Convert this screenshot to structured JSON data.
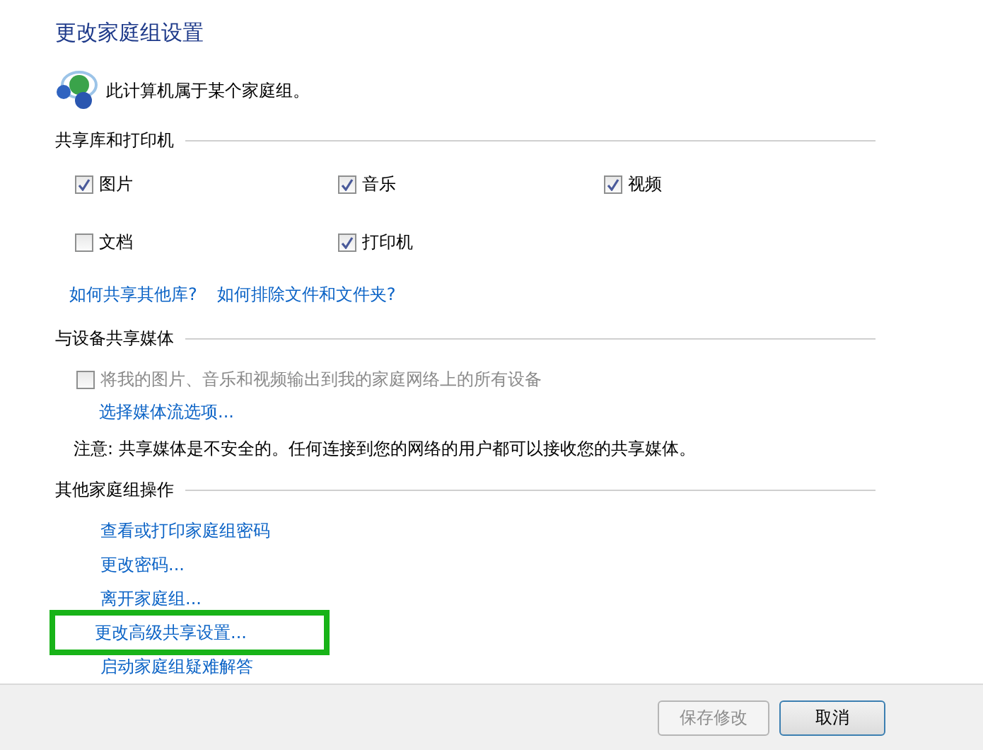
{
  "title": "更改家庭组设置",
  "status": {
    "text": "此计算机属于某个家庭组。"
  },
  "libraries": {
    "heading": "共享库和打印机",
    "items": [
      {
        "label": "图片",
        "checked": true
      },
      {
        "label": "音乐",
        "checked": true
      },
      {
        "label": "视频",
        "checked": true
      },
      {
        "label": "文档",
        "checked": false
      },
      {
        "label": "打印机",
        "checked": true
      }
    ],
    "links": [
      "如何共享其他库?",
      "如何排除文件和文件夹?"
    ]
  },
  "media": {
    "heading": "与设备共享媒体",
    "option": {
      "label": "将我的图片、音乐和视频输出到我的家庭网络上的所有设备",
      "checked": false,
      "disabled": true
    },
    "link": "选择媒体流选项...",
    "note": "注意: 共享媒体是不安全的。任何连接到您的网络的用户都可以接收您的共享媒体。"
  },
  "other": {
    "heading": "其他家庭组操作",
    "links": [
      {
        "label": "查看或打印家庭组密码",
        "highlighted": false
      },
      {
        "label": "更改密码...",
        "highlighted": false
      },
      {
        "label": "离开家庭组...",
        "highlighted": false
      },
      {
        "label": "更改高级共享设置...",
        "highlighted": true
      },
      {
        "label": "启动家庭组疑难解答",
        "highlighted": false
      }
    ]
  },
  "buttons": [
    {
      "label": "保存修改",
      "disabled": true
    },
    {
      "label": "取消",
      "disabled": false
    }
  ]
}
